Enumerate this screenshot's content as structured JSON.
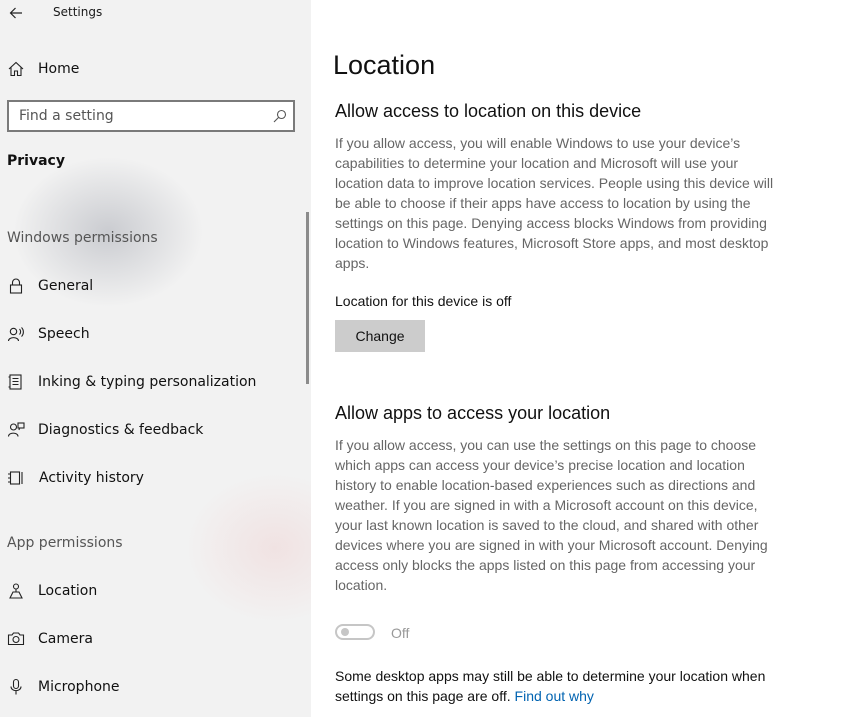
{
  "window": {
    "title": "Settings"
  },
  "sidebar": {
    "home_label": "Home",
    "search": {
      "placeholder": "Find a setting",
      "value": ""
    },
    "category": "Privacy",
    "windows_permissions": {
      "header": "Windows permissions",
      "items": [
        {
          "label": "General",
          "icon": "lock-icon"
        },
        {
          "label": "Speech",
          "icon": "speech-icon"
        },
        {
          "label": "Inking & typing personalization",
          "icon": "inking-icon"
        },
        {
          "label": "Diagnostics & feedback",
          "icon": "diagnostics-icon"
        },
        {
          "label": "Activity history",
          "icon": "activity-history-icon"
        }
      ]
    },
    "app_permissions": {
      "header": "App permissions",
      "items": [
        {
          "label": "Location",
          "icon": "location-icon",
          "selected": true
        },
        {
          "label": "Camera",
          "icon": "camera-icon"
        },
        {
          "label": "Microphone",
          "icon": "microphone-icon"
        }
      ]
    }
  },
  "main": {
    "title": "Location",
    "device_section": {
      "heading": "Allow access to location on this device",
      "description": "If you allow access, you will enable Windows to use your device’s capabilities to determine your location and Microsoft will use your location data to improve location services. People using this device will be able to choose if their apps have access to location by using the settings on this page. Denying access blocks Windows from providing location to Windows features, Microsoft Store apps, and most desktop apps.",
      "status": "Location for this device is off",
      "change_button": "Change"
    },
    "apps_section": {
      "heading": "Allow apps to access your location",
      "description": "If you allow access, you can use the settings on this page to choose which apps can access your device’s precise location and location history to enable location-based experiences such as directions and weather. If you are signed in with a Microsoft account on this device, your last known location is saved to the cloud, and shared with other devices where you are signed in with your Microsoft account. Denying access only blocks the apps listed on this page from accessing your location.",
      "toggle": {
        "state": "Off",
        "enabled": false
      }
    },
    "note": {
      "text": "Some desktop apps may still be able to determine your location when settings on this page are off. ",
      "link": "Find out why"
    }
  },
  "colors": {
    "accent": "#0063b1",
    "sidebar_bg": "#f2f2f2",
    "button_bg": "#cccccc"
  }
}
